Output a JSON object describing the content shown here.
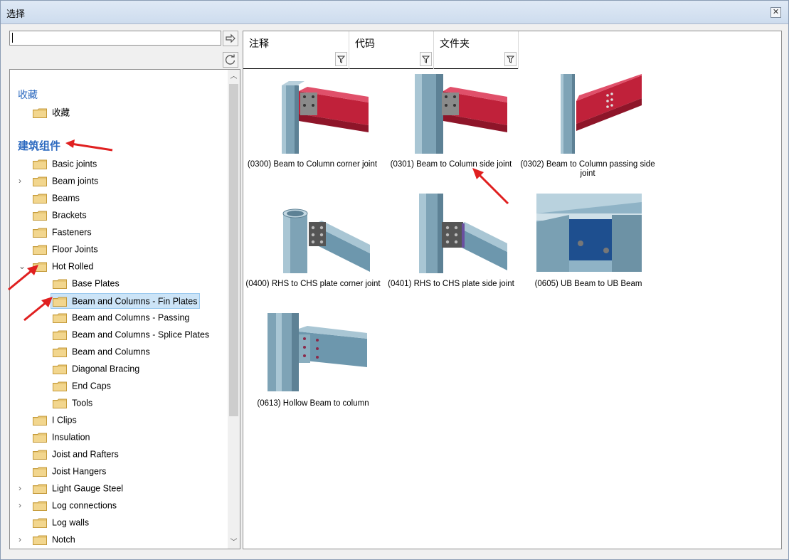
{
  "window": {
    "title": "选择",
    "close_glyph": "✕"
  },
  "search": {
    "value": "",
    "placeholder": ""
  },
  "tree": {
    "favorites_group": "收藏",
    "favorites_item": "收藏",
    "arch_group": "建筑组件",
    "items": [
      "Basic joints",
      "Beam joints",
      "Beams",
      "Brackets",
      "Fasteners",
      "Floor Joints",
      "Hot Rolled",
      "Base Plates",
      "Beam and Columns - Fin Plates",
      "Beam and Columns - Passing",
      "Beam and Columns - Splice Plates",
      "Beam and Columns",
      "Diagonal Bracing",
      "End Caps",
      "Tools",
      "I Clips",
      "Insulation",
      "Joist and Rafters",
      "Joist Hangers",
      "Light Gauge Steel",
      "Log connections",
      "Log walls",
      "Notch"
    ]
  },
  "columns": [
    "注释",
    "代码",
    "文件夹"
  ],
  "tiles": [
    "(0300) Beam to Column corner joint",
    "(0301) Beam to Column side joint",
    "(0302) Beam to Column passing side joint",
    "(0400) RHS to CHS plate corner joint",
    "(0401) RHS to CHS plate side joint",
    "(0605) UB Beam to UB Beam",
    "(0613) Hollow Beam to column"
  ],
  "colors": {
    "folder": "#e8c775",
    "accent": "#2d6ac0",
    "arrow": "#e02020",
    "beam_red": "#c0213a",
    "steel": "#6d97ad"
  }
}
